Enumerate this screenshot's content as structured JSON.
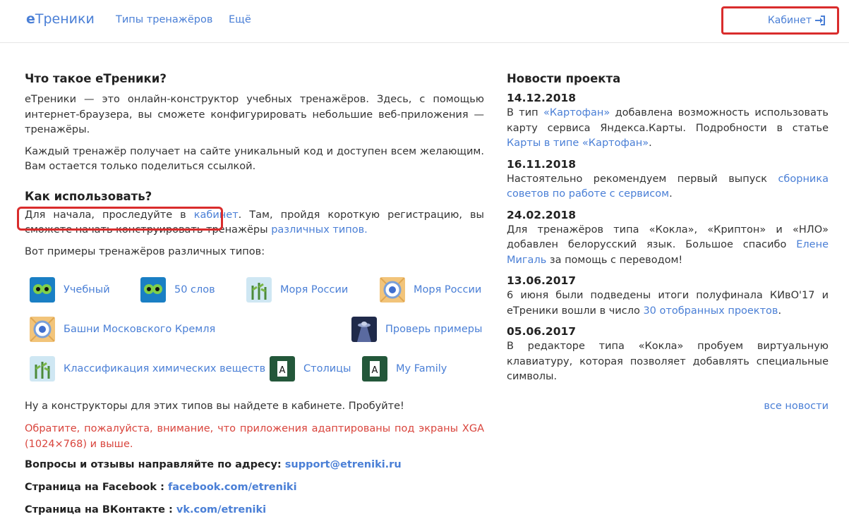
{
  "nav": {
    "brand_e": "е",
    "brand_rest": "Треники",
    "types": "Типы тренажёров",
    "more": "Ещё",
    "cabinet": "Кабинет"
  },
  "left": {
    "what_title": "Что такое еТреники?",
    "what_p1": "еТреники — это онлайн-конструктор учебных тренажёров. Здесь, с помощью интернет-браузера, вы сможете конфигурировать небольшие веб-приложения — тренажёры.",
    "what_p2": "Каждый тренажёр получает на сайте уникальный код и доступен всем желающим. Вам остается только поделиться ссылкой.",
    "how_title": "Как использовать?",
    "how_p_a": "Для начала, проследуйте в ",
    "how_link1": "кабинет",
    "how_p_b": ". Там, пройдя короткую регистрацию, вы сможете начать конструировать тренажёры ",
    "how_link2": "различных типов.",
    "examples_intro": "Вот примеры тренажёров различных типов:",
    "examples": [
      {
        "label": "Учебный",
        "icon": "owl-icon"
      },
      {
        "label": "50 слов",
        "icon": "owl-icon"
      },
      {
        "label": "Моря России",
        "icon": "plants-icon"
      },
      {
        "label": "Моря России",
        "icon": "map-target-icon"
      },
      {
        "label": "Башни Московского Кремля",
        "icon": "map-target-icon"
      },
      {
        "label": "Проверь примеры",
        "icon": "ufo-icon"
      },
      {
        "label": "Классификация химических веществ",
        "icon": "plants-icon"
      },
      {
        "label": "Столицы",
        "icon": "card-a-icon"
      },
      {
        "label": "My Family",
        "icon": "card-a-icon"
      }
    ],
    "constructors": "Ну а конструкторы для этих типов вы найдете в кабинете. Пробуйте!",
    "warning": "Обратите, пожалуйста, внимание, что приложения адаптированы под экраны XGA (1024×768) и выше.",
    "contact_label": "Вопросы и отзывы направляйте по адресу:",
    "contact_email": "support@etreniki.ru",
    "fb_label": "Страница на Facebook :",
    "fb_link": "facebook.com/etreniki",
    "vk_label": "Страница на ВКонтакте :",
    "vk_link": "vk.com/etreniki"
  },
  "news": {
    "title": "Новости проекта",
    "items": [
      {
        "date": "14.12.2018",
        "a": "В тип ",
        "l1": "«Картофан»",
        "b": " добавлена возможность использовать карту сервиса Яндекса.Карты. Подробности в статье ",
        "l2": "Карты в типе «Картофан»",
        "c": "."
      },
      {
        "date": "16.11.2018",
        "a": "Настоятельно рекомендуем первый выпуск ",
        "l1": "сборника советов по работе с сервисом",
        "b": ".",
        "l2": "",
        "c": ""
      },
      {
        "date": "24.02.2018",
        "a": "Для тренажёров типа «Кокла», «Криптон» и «НЛО» добавлен белорусский язык. Большое спасибо ",
        "l1": "Елене Мигаль",
        "b": " за помощь с переводом!",
        "l2": "",
        "c": ""
      },
      {
        "date": "13.06.2017",
        "a": "6 июня были подведены итоги полуфинала КИвО'17 и еТреники вошли в число ",
        "l1": "30 отобранных проектов",
        "b": ".",
        "l2": "",
        "c": ""
      },
      {
        "date": "05.06.2017",
        "a": "В редакторе типа «Кокла» пробуем виртуальную клавиатуру, которая позволяет добавлять специальные символы.",
        "l1": "",
        "b": "",
        "l2": "",
        "c": ""
      }
    ],
    "all": "все новости"
  },
  "colors": {
    "link": "#4a7fd6",
    "highlight": "#d92c2c",
    "warning": "#d9443c"
  }
}
